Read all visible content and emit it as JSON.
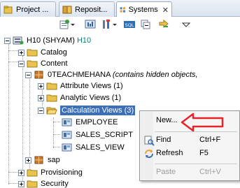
{
  "tabs": [
    {
      "label": "Project ...",
      "icon": "project-explorer-icon"
    },
    {
      "label": "Reposit...",
      "icon": "repository-icon"
    },
    {
      "label": "Systems",
      "icon": "systems-icon",
      "active": true,
      "close": "✕"
    }
  ],
  "toolbar": {
    "buttons": [
      "add-system-icon",
      "dropdown-icon",
      "sql-console-icon",
      "tools-icon",
      "dropdown-icon",
      "sql-icon",
      "collapse-icon",
      "link-icon",
      "view-menu-icon"
    ]
  },
  "tree": {
    "root": {
      "label": "H10 (SHYAM)",
      "suffix": "H10"
    },
    "catalog": "Catalog",
    "content": "Content",
    "package": {
      "label": "0TEACHMEHANA",
      "hint": "(contains hidden objects,"
    },
    "attribute_views": "Attribute Views (1)",
    "analytic_views": "Analytic Views (1)",
    "calculation_views": "Calculation Views (3)",
    "employee": "EMPLOYEE",
    "sales_script": "SALES_SCRIPT",
    "sales_view": "SALES_VIEW",
    "sap": "sap",
    "provisioning": "Provisioning",
    "security": "Security"
  },
  "context_menu": {
    "new": "New...",
    "find": "Find",
    "find_key": "Ctrl+F",
    "refresh": "Refresh",
    "refresh_key": "F5",
    "paste": "Paste",
    "paste_key": "Ctrl+V"
  },
  "colors": {
    "selection": "#3c6fb8",
    "accent_arrow": "#e8242b",
    "folder": "#e8c44e"
  }
}
